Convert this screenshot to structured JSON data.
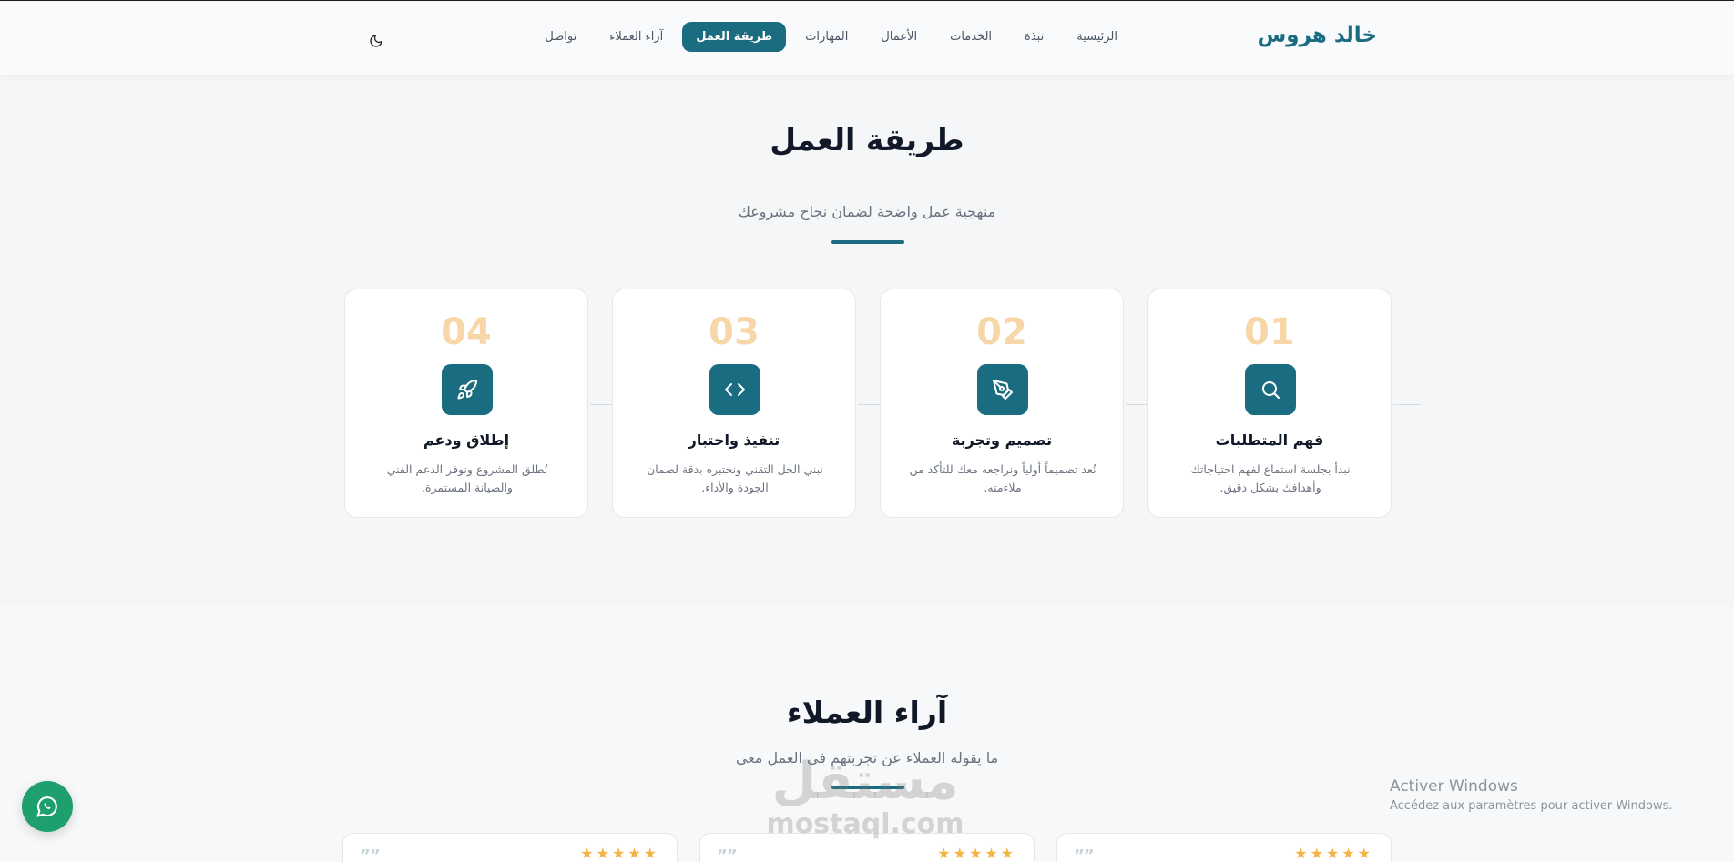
{
  "header": {
    "brand": "خالد هروس",
    "nav": [
      {
        "label": "الرئيسية",
        "active": false
      },
      {
        "label": "نبذة",
        "active": false
      },
      {
        "label": "الخدمات",
        "active": false
      },
      {
        "label": "الأعمال",
        "active": false
      },
      {
        "label": "المهارات",
        "active": false
      },
      {
        "label": "طريقة العمل",
        "active": true
      },
      {
        "label": "آراء العملاء",
        "active": false
      },
      {
        "label": "تواصل",
        "active": false
      }
    ],
    "theme_toggle_icon": "moon-icon"
  },
  "process": {
    "title": "طريقة العمل",
    "subtitle": "منهجية عمل واضحة لضمان نجاح مشروعك",
    "steps": [
      {
        "number": "01",
        "icon": "search-icon",
        "title": "فهم المتطلبات",
        "desc": "نبدأ بجلسة استماع لفهم احتياجاتك وأهدافك بشكل دقيق."
      },
      {
        "number": "02",
        "icon": "pen-tool-icon",
        "title": "تصميم وتجربة",
        "desc": "نُعد تصميماً أولياً ونراجعه معك للتأكد من ملاءمته."
      },
      {
        "number": "03",
        "icon": "code-icon",
        "title": "تنفيذ واختبار",
        "desc": "نبني الحل التقني ونختبره بدقة لضمان الجودة والأداء."
      },
      {
        "number": "04",
        "icon": "rocket-icon",
        "title": "إطلاق ودعم",
        "desc": "نُطلق المشروع ونوفر الدعم الفني والصيانة المستمرة."
      }
    ]
  },
  "testimonials": {
    "title": "آراء العملاء",
    "subtitle": "ما يقوله العملاء عن تجربتهم في العمل معي",
    "cards": [
      {
        "quote": "””",
        "stars": 5
      },
      {
        "quote": "””",
        "stars": 5
      },
      {
        "quote": "””",
        "stars": 5
      }
    ]
  },
  "floating": {
    "chat_icon": "whatsapp-icon",
    "watermark_ar": "مستقل",
    "watermark_en": "mostaql.com"
  },
  "os_overlay": {
    "activation_title": "Activer Windows",
    "activation_sub": "Accédez aux paramètres pour activer Windows."
  },
  "colors": {
    "primary": "#1a6c80",
    "step_number": "#f7d6a8",
    "chat_button": "#1e9f6e",
    "star": "#f5b342"
  }
}
